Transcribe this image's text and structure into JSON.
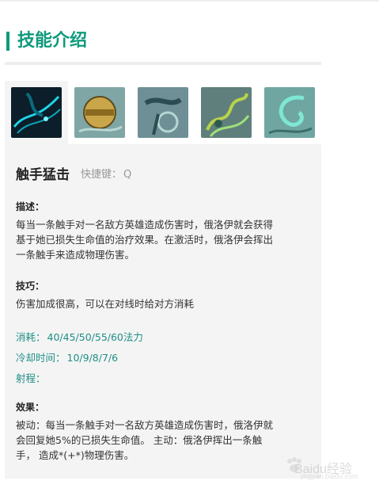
{
  "section": {
    "title": "技能介绍"
  },
  "icons": [
    {
      "name": "skill-icon-1",
      "active": true,
      "palette": [
        "#0b1e2a",
        "#1fd3e6",
        "#0a6b7c"
      ]
    },
    {
      "name": "skill-icon-2",
      "active": false,
      "palette": [
        "#7fa6a4",
        "#caa64a",
        "#5d7a76"
      ]
    },
    {
      "name": "skill-icon-3",
      "active": false,
      "palette": [
        "#6d8f95",
        "#2c4b52",
        "#b7d6d3"
      ]
    },
    {
      "name": "skill-icon-4",
      "active": false,
      "palette": [
        "#5f7f7c",
        "#b7d34a",
        "#2d5b4f"
      ]
    },
    {
      "name": "skill-icon-5",
      "active": false,
      "palette": [
        "#6fa6a2",
        "#7ee7d4",
        "#3c6e6a"
      ]
    }
  ],
  "skill": {
    "name": "触手猛击",
    "hotkey_label": "快捷键：",
    "hotkey": "Q",
    "desc_label": "描述：",
    "desc_lines": [
      "每当一条触手对一名敌方英雄造成伤害时，俄洛伊就会获得",
      "基于她已损失生命值的治疗效果。在激活时，俄洛伊会挥出",
      "一条触手来造成物理伤害。"
    ],
    "tips_label": "技巧：",
    "tips": "伤害加成很高，可以在对线时给对方消耗",
    "cost_label": "消耗：",
    "cost": "40/45/50/55/60法力",
    "cooldown_label": "冷却时间：",
    "cooldown": "10/9/8/7/6",
    "range_label": "射程：",
    "range": "",
    "effect_label": "效果：",
    "effect_lines": [
      "被动：每当一条触手对一名敌方英雄造成伤害时，俄洛伊就",
      "会回复她5%的已损失生命值。 主动：俄洛伊挥出一条触",
      "手， 造成*(+*)物理伤害。"
    ]
  },
  "watermark": {
    "text": "Baidu经验",
    "sub": "jingyan.baidu.com"
  }
}
